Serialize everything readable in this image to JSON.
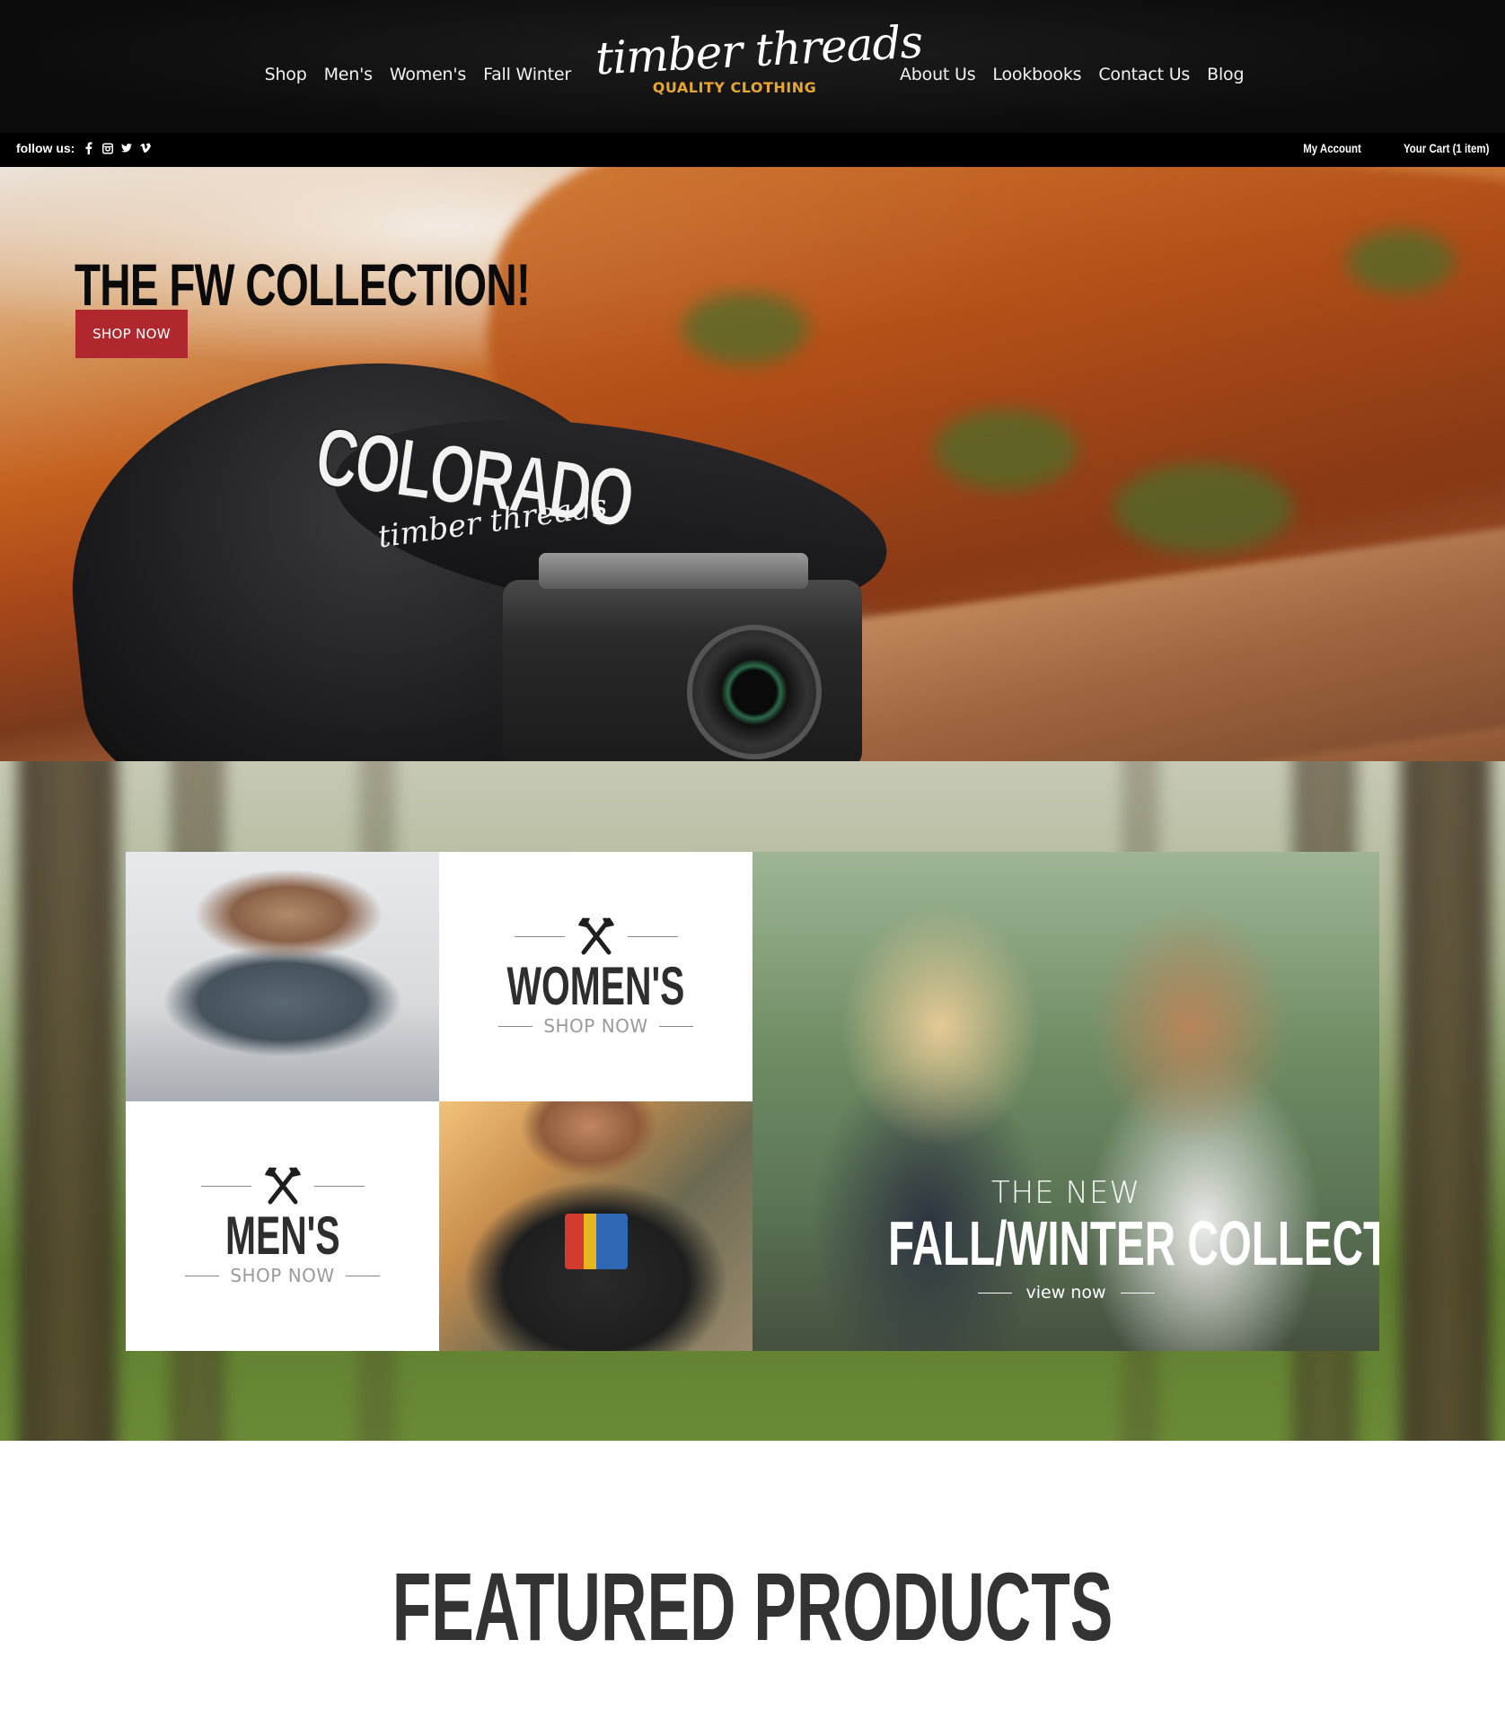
{
  "header": {
    "nav_left": [
      "Shop",
      "Men's",
      "Women's",
      "Fall Winter"
    ],
    "nav_right": [
      "About Us",
      "Lookbooks",
      "Contact Us",
      "Blog"
    ],
    "logo": "timber threads",
    "tagline": "QUALITY CLOTHING",
    "tagline_color": "#e7a62f"
  },
  "utility_bar": {
    "follow_label": "follow us:",
    "social": [
      {
        "icon": "facebook-icon",
        "glyph": "f"
      },
      {
        "icon": "instagram-icon",
        "glyph": "◘"
      },
      {
        "icon": "twitter-icon",
        "glyph": "♥"
      },
      {
        "icon": "vimeo-icon",
        "glyph": "v"
      }
    ],
    "account": "My Account",
    "cart": "Your Cart (1 item)"
  },
  "hero": {
    "title": "THE FW COLLECTION!",
    "button": "SHOP NOW",
    "button_color": "#b0282e",
    "cap_text_top": "COLORADO",
    "cap_text_bottom": "timber threads"
  },
  "categories": {
    "womens": {
      "title": "WOMEN'S",
      "cta": "SHOP NOW"
    },
    "mens": {
      "title": "MEN'S",
      "cta": "SHOP NOW"
    },
    "fw": {
      "subtitle": "THE NEW",
      "title": "FALL/WINTER COLLECTION",
      "cta": "view now"
    }
  },
  "featured": {
    "title": "FEATURED PRODUCTS"
  }
}
